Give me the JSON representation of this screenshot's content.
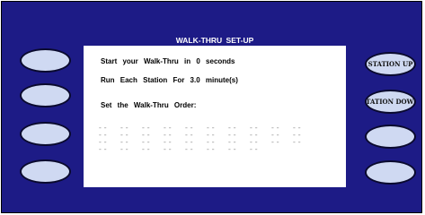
{
  "screen": {
    "title": "WALK-THRU SET-UP",
    "line1": "Start your Walk-Thru in 0 seconds",
    "line2": "Run Each Station For 3.0 minute(s)",
    "line3": "Set the Walk-Thru Order:",
    "order_rows": [
      [
        "--",
        "--",
        "--",
        "--",
        "--",
        "--",
        "--",
        "--",
        "--",
        "--"
      ],
      [
        "--",
        "--",
        "--",
        "--",
        "--",
        "--",
        "--",
        "--",
        "--",
        "--"
      ],
      [
        "--",
        "--",
        "--",
        "--",
        "--",
        "--",
        "--",
        "--",
        "--",
        "--"
      ],
      [
        "--",
        "--",
        "--",
        "--",
        "--",
        "--",
        "--",
        "--"
      ]
    ]
  },
  "buttons": {
    "left": [
      "",
      "",
      "",
      ""
    ],
    "right": [
      "STATION UP",
      "STATION DOWN",
      "",
      ""
    ]
  },
  "colors": {
    "panel": "#1d1b86",
    "button_fill": "#cfd9f2",
    "placeholder": "#8a8a8a"
  }
}
